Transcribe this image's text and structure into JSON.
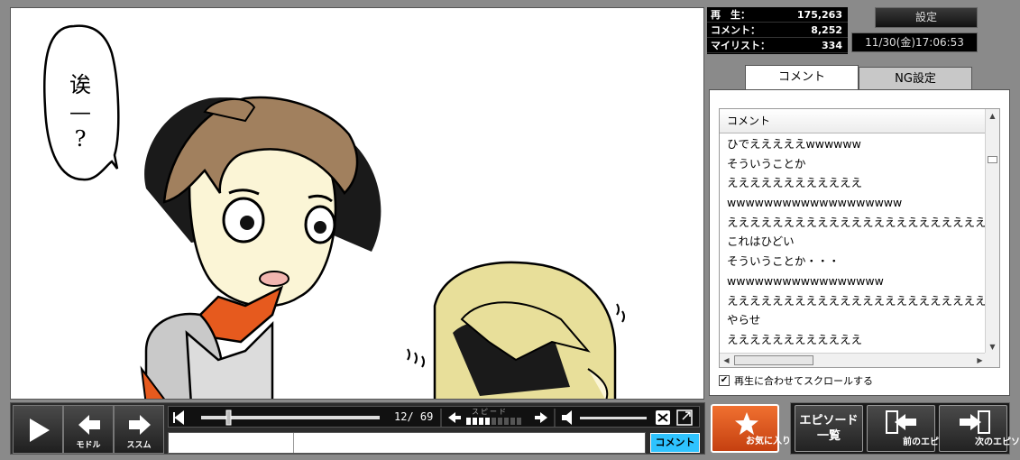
{
  "video": {
    "speech_bubble": "诶\n—\n?"
  },
  "stats": {
    "plays_label": "再　生：",
    "plays_value": "175,263",
    "comments_label": "コメント：",
    "comments_value": "8,252",
    "mylist_label": "マイリスト：",
    "mylist_value": "334"
  },
  "header": {
    "settings_label": "設定",
    "datetime": "11/30(金)17:06:53"
  },
  "tabs": {
    "comment": "コメント",
    "ng": "NG設定"
  },
  "comment_list": {
    "column_header": "コメント",
    "rows": [
      "ひでえええええwwwwww",
      "そういうことか",
      "ええええええええええええ",
      "wwwwwwwwwwwwwwwwwww",
      "ええええええええええええええええええええええええええ",
      "これはひどい",
      "そういうことか・・・",
      "wwwwwwwwwwwwwwwww",
      "ええええええええええええええええええええええええええ",
      "やらせ",
      "ええええええええええええ"
    ],
    "auto_scroll_label": "再生に合わせてスクロールする"
  },
  "controls": {
    "back_label": "モドル",
    "forward_label": "ススム",
    "time": "12/ 69",
    "speed_label": "スピード",
    "comment_submit": "コメント"
  },
  "actions": {
    "favorite": "お気に入り登録",
    "episode_list": "エピソード\n一覧",
    "prev_episode": "前のエピソード",
    "next_episode": "次のエピソード"
  },
  "colors": {
    "accent_orange": "#e65a1e",
    "comment_button": "#2ec3ff"
  }
}
